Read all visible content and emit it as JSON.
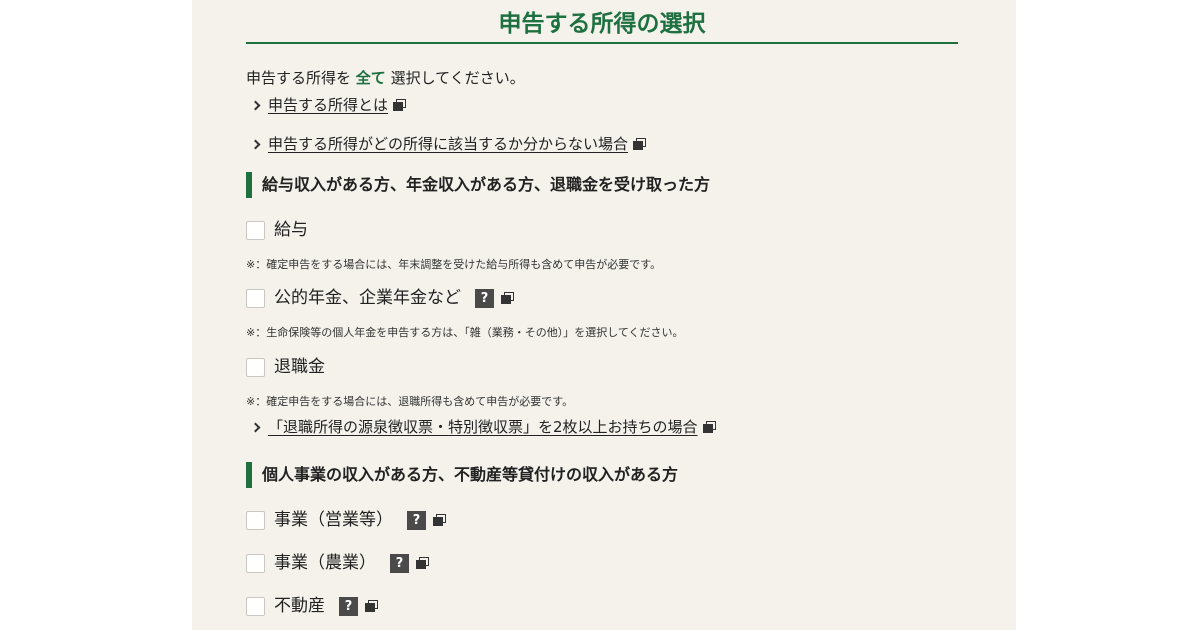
{
  "page": {
    "title": "申告する所得の選択",
    "intro_prefix": "申告する所得を",
    "intro_emphasis": "全て",
    "intro_suffix": "選択してください。"
  },
  "links": {
    "what_is_income": "申告する所得とは",
    "unsure_category": "申告する所得がどの所得に該当するか分からない場合",
    "multiple_slips": "「退職所得の源泉徴収票・特別徴収票」を2枚以上お持ちの場合"
  },
  "sections": [
    {
      "heading": "給与収入がある方、年金収入がある方、退職金を受け取った方"
    },
    {
      "heading": "個人事業の収入がある方、不動産等貸付けの収入がある方"
    }
  ],
  "options": {
    "salary": {
      "label": "給与",
      "checked": false,
      "note": "※：確定申告をする場合には、年末調整を受けた給与所得も含めて申告が必要です。"
    },
    "pension": {
      "label": "公的年金、企業年金など",
      "checked": false,
      "note": "※：生命保険等の個人年金を申告する方は、「雑（業務・その他）」を選択してください。"
    },
    "retirement": {
      "label": "退職金",
      "checked": false,
      "note": "※：確定申告をする場合には、退職所得も含めて申告が必要です。"
    },
    "business_sales": {
      "label": "事業（営業等）",
      "checked": false
    },
    "business_farm": {
      "label": "事業（農業）",
      "checked": false
    },
    "real_estate": {
      "label": "不動産",
      "checked": false
    }
  },
  "icons": {
    "help": "?",
    "help_name": "question-icon",
    "external": "new-window-icon"
  },
  "colors": {
    "accent": "#1e7040",
    "panel_bg": "#f4f2eb",
    "help_bg": "#4a4a4a"
  }
}
